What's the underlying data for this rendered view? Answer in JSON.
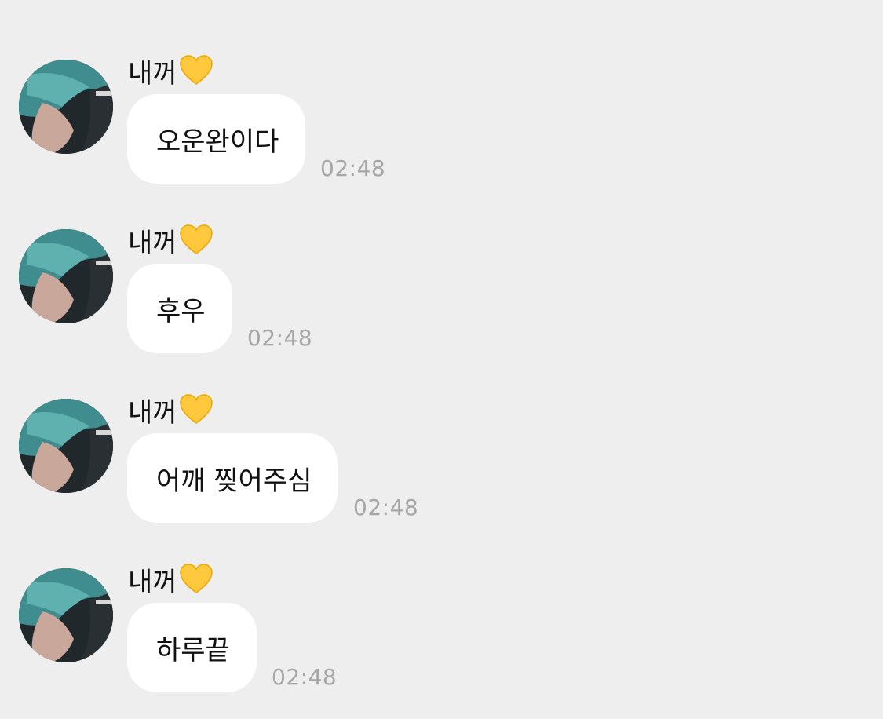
{
  "chat": {
    "messages": [
      {
        "sender": "내꺼",
        "text": "오운완이다",
        "time": "02:48"
      },
      {
        "sender": "내꺼",
        "text": "후우",
        "time": "02:48"
      },
      {
        "sender": "내꺼",
        "text": "어깨 찢어주심",
        "time": "02:48"
      },
      {
        "sender": "내꺼",
        "text": "하루끝",
        "time": "02:48"
      }
    ],
    "sender_emoji_icon": "yellow-heart-icon",
    "colors": {
      "background": "#eeeeee",
      "bubble": "#ffffff",
      "timestamp": "#a6a6a6",
      "heart": "#ffc83d"
    }
  }
}
